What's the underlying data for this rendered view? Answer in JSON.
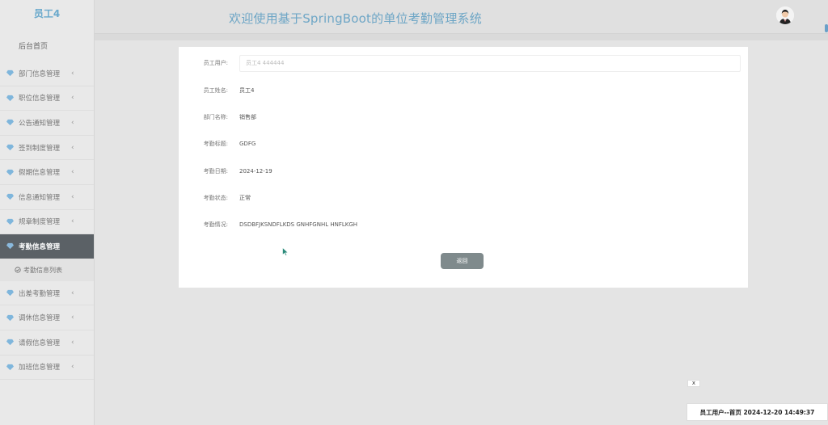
{
  "sidebar": {
    "brand": "员工4",
    "home": "后台首页",
    "items": [
      {
        "label": "部门信息管理"
      },
      {
        "label": "职位信息管理"
      },
      {
        "label": "公告通知管理"
      },
      {
        "label": "签到制度管理"
      },
      {
        "label": "假期信息管理"
      },
      {
        "label": "信息通知管理"
      },
      {
        "label": "规章制度管理"
      },
      {
        "label": "考勤信息管理",
        "active": true
      },
      {
        "label": "出差考勤管理"
      },
      {
        "label": "调休信息管理"
      },
      {
        "label": "请假信息管理"
      },
      {
        "label": "加班信息管理"
      }
    ],
    "sub_item": "考勤信息列表"
  },
  "header": {
    "title": "欢迎使用基于SpringBoot的单位考勤管理系统"
  },
  "form": {
    "employee_user_label": "员工用户:",
    "employee_user_value": "员工4 444444",
    "employee_name_label": "员工姓名:",
    "employee_name_value": "员工4",
    "department_label": "部门名称:",
    "department_value": "销售部",
    "attendance_title_label": "考勤标题:",
    "attendance_title_value": "GDFG",
    "attendance_time_label": "考勤日期:",
    "attendance_time_value": "2024-12-19",
    "attendance_status_label": "考勤状态:",
    "attendance_status_value": "正常",
    "attendance_detail_label": "考勤情况:",
    "attendance_detail_value": "DSDBFJKSNDFLKDS GNHFGNHL HNFLKGH",
    "back_label": "返回"
  },
  "footer": {
    "close_label": "x",
    "status_text": "员工用户--首页 2024-12-20 14:49:37"
  },
  "colors": {
    "accent": "#6ea6c6",
    "active_nav": "#5b6166",
    "button": "#7f8a8c"
  }
}
